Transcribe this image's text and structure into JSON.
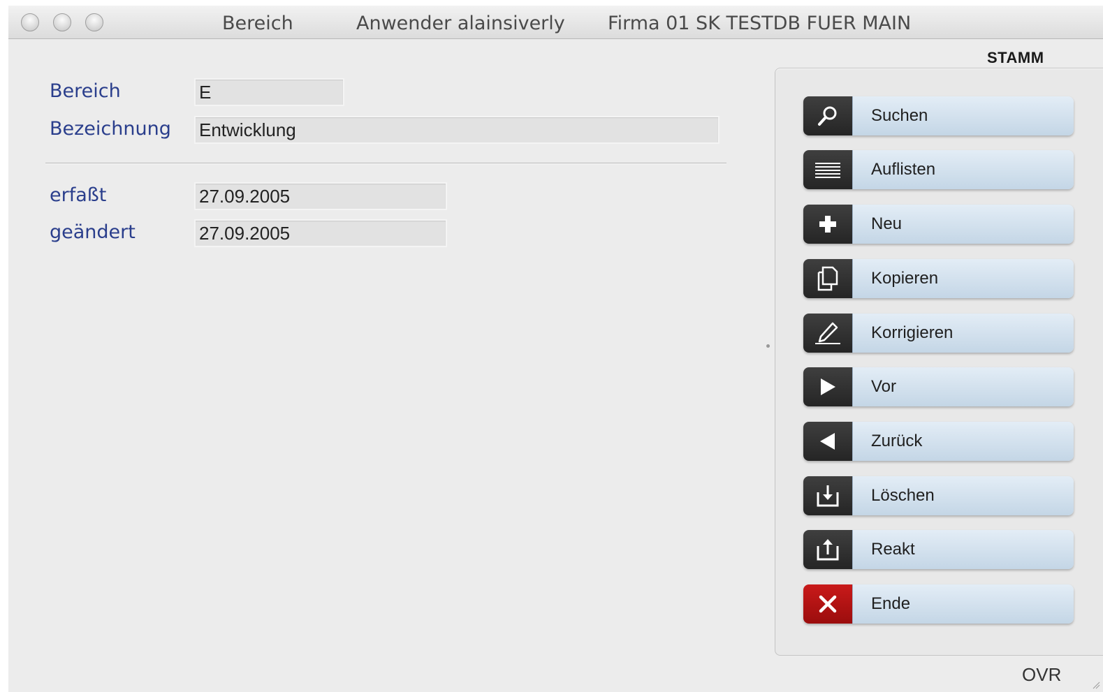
{
  "titlebar": {
    "window_title": "Bereich",
    "user": "Anwender alainsiverly",
    "company": "Firma 01 SK TESTDB FUER MAIN"
  },
  "form": {
    "bereich": {
      "label": "Bereich",
      "value": "E"
    },
    "bezeichnung": {
      "label": "Bezeichnung",
      "value": "Entwicklung"
    },
    "erfasst": {
      "label": "erfaßt",
      "value": "27.09.2005"
    },
    "geaendert": {
      "label": "geändert",
      "value": "27.09.2005"
    }
  },
  "panel": {
    "title": "STAMM",
    "buttons": [
      {
        "label": "Suchen",
        "icon": "search-icon"
      },
      {
        "label": "Auflisten",
        "icon": "list-icon"
      },
      {
        "label": "Neu",
        "icon": "plus-icon"
      },
      {
        "label": "Kopieren",
        "icon": "copy-icon"
      },
      {
        "label": "Korrigieren",
        "icon": "pen-icon"
      },
      {
        "label": "Vor",
        "icon": "play-forward-icon"
      },
      {
        "label": "Zurück",
        "icon": "play-back-icon"
      },
      {
        "label": "Löschen",
        "icon": "tray-download-icon"
      },
      {
        "label": "Reakt",
        "icon": "tray-upload-icon"
      },
      {
        "label": "Ende",
        "icon": "close-x-icon",
        "accent": "#b01515"
      }
    ]
  },
  "status": {
    "mode": "OVR"
  }
}
